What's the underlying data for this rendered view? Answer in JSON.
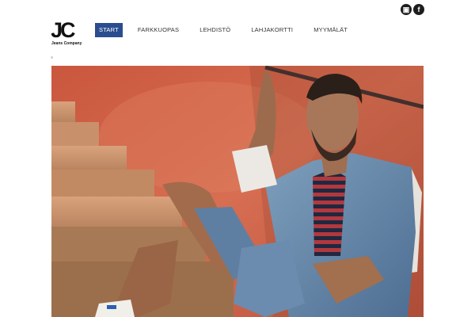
{
  "brand": {
    "logo_text": "JC",
    "tagline": "Jeans Company"
  },
  "social": {
    "items": [
      {
        "name": "instagram",
        "glyph": "▣"
      },
      {
        "name": "facebook",
        "glyph": "f"
      }
    ]
  },
  "nav": {
    "items": [
      {
        "label": "START",
        "active": true
      },
      {
        "label": "FARKKUOPAS",
        "active": false
      },
      {
        "label": "LEHDISTÖ",
        "active": false
      },
      {
        "label": "LAHJAKORTTI",
        "active": false
      },
      {
        "label": "MYYMÄLÄT",
        "active": false
      }
    ]
  },
  "colors": {
    "accent": "#2a4d8f",
    "wall": "#d4694f",
    "icon": "#1d1d1d"
  },
  "hero": {
    "icon": "hero-photo"
  }
}
